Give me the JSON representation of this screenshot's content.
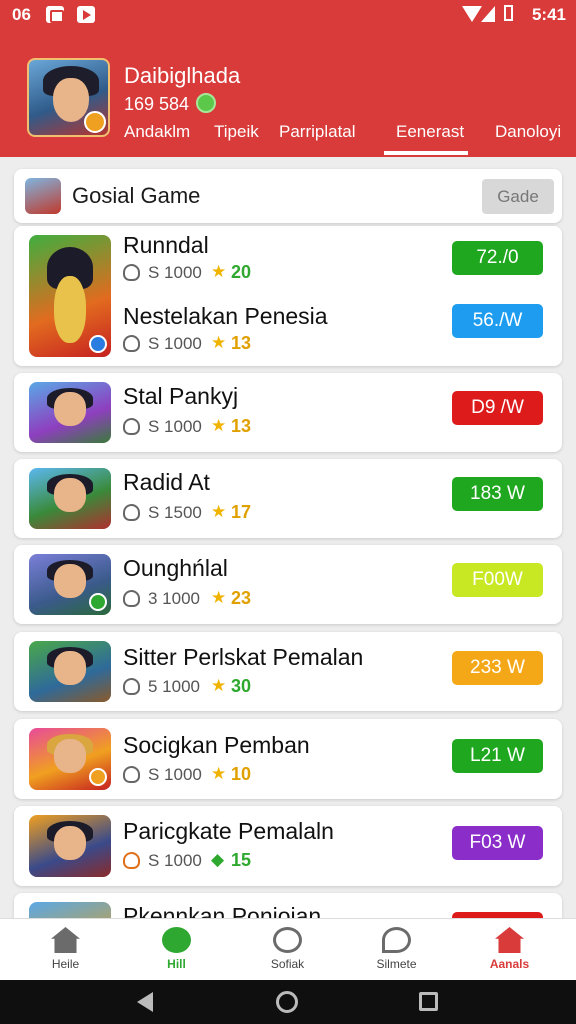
{
  "status_bar": {
    "time_left": "06",
    "time_right": "5:41"
  },
  "profile": {
    "name": "Daibiglhada",
    "score": "169 584"
  },
  "tabs": [
    {
      "label": "Andaklm"
    },
    {
      "label": "Tipeik"
    },
    {
      "label": "Parriplatal"
    },
    {
      "label": "Eenerast",
      "active": true
    },
    {
      "label": "Danoloyi"
    }
  ],
  "section": {
    "title": "Gosial Game",
    "button_label": "Gade"
  },
  "games": [
    {
      "title": "Runndal",
      "count": "S 1000",
      "rating": "20",
      "rating_color": "#2ea82e",
      "button": "72./0",
      "button_color": "#1fa81f"
    },
    {
      "title": "Nestelakan Penesia",
      "count": "S 1000",
      "rating": "13",
      "rating_color": "#e0a000",
      "button": "56./W",
      "button_color": "#1e9df0"
    },
    {
      "title": "Stal Pankyj",
      "count": "S 1000",
      "rating": "13",
      "rating_color": "#e0a000",
      "button": "D9 /W",
      "button_color": "#dd1b1b"
    },
    {
      "title": "Radid At",
      "count": "S 1500",
      "rating": "17",
      "rating_color": "#e0a000",
      "button": "183 W",
      "button_color": "#1fa81f"
    },
    {
      "title": "Ounghńlal",
      "count": "3 1000",
      "rating": "23",
      "rating_color": "#e0a000",
      "button": "F00W",
      "button_color": "#c8e824"
    },
    {
      "title": "Sitter Perlskat Pemalan",
      "count": "5 1000",
      "rating": "30",
      "rating_color": "#2ea82e",
      "button": "233 W",
      "button_color": "#f5a817"
    },
    {
      "title": "Socigkan Pemban",
      "count": "S 1000",
      "rating": "10",
      "rating_color": "#e0a000",
      "button": "L21 W",
      "button_color": "#1fa81f"
    },
    {
      "title": "Paricgkate Pemalaln",
      "count": "S 1000",
      "rating": "15",
      "rating_color": "#2ea82e",
      "button": "F03 W",
      "button_color": "#8a2dc9"
    },
    {
      "title": "Pkennkan Ponioian",
      "count": "",
      "rating": "",
      "rating_color": "#e0a000",
      "button": "",
      "button_color": "#dd1b1b"
    }
  ],
  "bottom_nav": [
    {
      "label": "Heile",
      "icon": "home-icon"
    },
    {
      "label": "Hill",
      "icon": "hill-icon",
      "active": true
    },
    {
      "label": "Sofiak",
      "icon": "social-icon"
    },
    {
      "label": "Silmete",
      "icon": "search-icon"
    },
    {
      "label": "Aanals",
      "icon": "apps-icon",
      "active": true
    }
  ],
  "colors": {
    "header": "#d93a3a",
    "accent_green": "#2fa832",
    "accent_red": "#d93a3a"
  }
}
